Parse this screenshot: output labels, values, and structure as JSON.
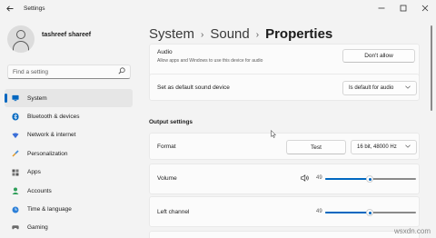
{
  "window": {
    "title": "Settings",
    "back_icon": "back-arrow-icon",
    "controls": [
      "minimize-icon",
      "maximize-icon",
      "close-icon"
    ]
  },
  "profile": {
    "name": "tashreef shareef"
  },
  "search": {
    "placeholder": "Find a setting",
    "icon": "search-icon"
  },
  "nav": {
    "items": [
      {
        "label": "System",
        "icon": "system-icon",
        "color": "#0067c0",
        "active": true
      },
      {
        "label": "Bluetooth & devices",
        "icon": "bluetooth-icon",
        "color": "#0067c0"
      },
      {
        "label": "Network & internet",
        "icon": "network-icon",
        "color": "#3b6fd8"
      },
      {
        "label": "Personalization",
        "icon": "personalization-icon",
        "color": "#e39b2b"
      },
      {
        "label": "Apps",
        "icon": "apps-icon",
        "color": "#555555"
      },
      {
        "label": "Accounts",
        "icon": "accounts-icon",
        "color": "#2e9e59"
      },
      {
        "label": "Time & language",
        "icon": "time-language-icon",
        "color": "#2b7fd8"
      },
      {
        "label": "Gaming",
        "icon": "gaming-icon",
        "color": "#6b6b6b"
      }
    ]
  },
  "breadcrumb": {
    "items": [
      "System",
      "Sound"
    ],
    "current": "Properties",
    "separator": "›"
  },
  "audio_card": {
    "title": "Audio",
    "description": "Allow apps and Windows to use this device for audio",
    "button": "Don't allow"
  },
  "default_card": {
    "title": "Set as default sound device",
    "dropdown_value": "Is default for audio"
  },
  "output_settings": {
    "section_title": "Output settings",
    "format": {
      "title": "Format",
      "test_button": "Test",
      "dropdown_value": "16 bit, 48000 Hz"
    },
    "volume": {
      "title": "Volume",
      "value": "49",
      "level": 0.49
    },
    "left_channel": {
      "title": "Left channel",
      "value": "49",
      "level": 0.49
    }
  },
  "colors": {
    "accent": "#0067c0",
    "background": "#f3f3f3",
    "card": "#fbfbfb"
  },
  "watermark": "wsxdn.com"
}
